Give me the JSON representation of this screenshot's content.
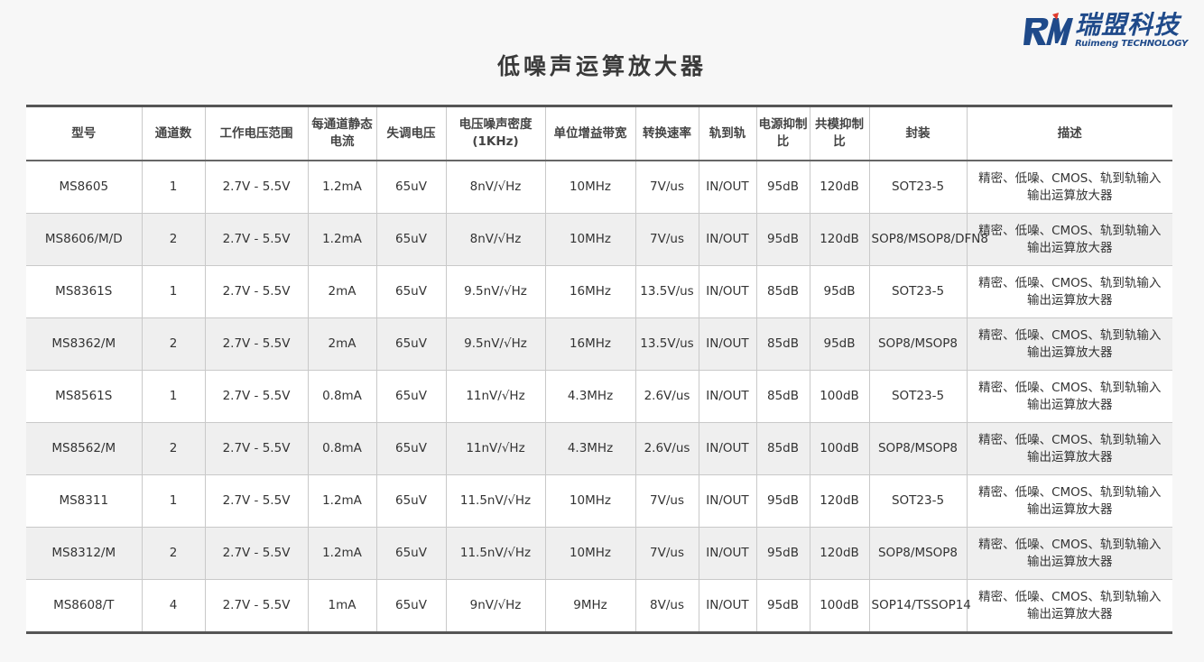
{
  "brand": {
    "name_cn": "瑞盟科技",
    "name_en": "Ruimeng TECHNOLOGY",
    "accent": "#1f4a8a",
    "logo_icon": "rm-logo-icon"
  },
  "page": {
    "title": "低噪声运算放大器"
  },
  "table": {
    "headers": [
      "型号",
      "通道数",
      "工作电压范围",
      "每通道静态电流",
      "失调电压",
      "电压噪声密度(1KHz)",
      "单位增益带宽",
      "转换速率",
      "轨到轨",
      "电源抑制比",
      "共模抑制比",
      "封装",
      "描述"
    ],
    "rows": [
      [
        "MS8605",
        "1",
        "2.7V - 5.5V",
        "1.2mA",
        "65uV",
        "8nV/√Hz",
        "10MHz",
        "7V/us",
        "IN/OUT",
        "95dB",
        "120dB",
        "SOT23-5",
        "精密、低噪、CMOS、轨到轨输入输出运算放大器"
      ],
      [
        "MS8606/M/D",
        "2",
        "2.7V - 5.5V",
        "1.2mA",
        "65uV",
        "8nV/√Hz",
        "10MHz",
        "7V/us",
        "IN/OUT",
        "95dB",
        "120dB",
        "SOP8/MSOP8/DFN8",
        "精密、低噪、CMOS、轨到轨输入输出运算放大器"
      ],
      [
        "MS8361S",
        "1",
        "2.7V - 5.5V",
        "2mA",
        "65uV",
        "9.5nV/√Hz",
        "16MHz",
        "13.5V/us",
        "IN/OUT",
        "85dB",
        "95dB",
        "SOT23-5",
        "精密、低噪、CMOS、轨到轨输入输出运算放大器"
      ],
      [
        "MS8362/M",
        "2",
        "2.7V - 5.5V",
        "2mA",
        "65uV",
        "9.5nV/√Hz",
        "16MHz",
        "13.5V/us",
        "IN/OUT",
        "85dB",
        "95dB",
        "SOP8/MSOP8",
        "精密、低噪、CMOS、轨到轨输入输出运算放大器"
      ],
      [
        "MS8561S",
        "1",
        "2.7V - 5.5V",
        "0.8mA",
        "65uV",
        "11nV/√Hz",
        "4.3MHz",
        "2.6V/us",
        "IN/OUT",
        "85dB",
        "100dB",
        "SOT23-5",
        "精密、低噪、CMOS、轨到轨输入输出运算放大器"
      ],
      [
        "MS8562/M",
        "2",
        "2.7V - 5.5V",
        "0.8mA",
        "65uV",
        "11nV/√Hz",
        "4.3MHz",
        "2.6V/us",
        "IN/OUT",
        "85dB",
        "100dB",
        "SOP8/MSOP8",
        "精密、低噪、CMOS、轨到轨输入输出运算放大器"
      ],
      [
        "MS8311",
        "1",
        "2.7V - 5.5V",
        "1.2mA",
        "65uV",
        "11.5nV/√Hz",
        "10MHz",
        "7V/us",
        "IN/OUT",
        "95dB",
        "120dB",
        "SOT23-5",
        "精密、低噪、CMOS、轨到轨输入输出运算放大器"
      ],
      [
        "MS8312/M",
        "2",
        "2.7V - 5.5V",
        "1.2mA",
        "65uV",
        "11.5nV/√Hz",
        "10MHz",
        "7V/us",
        "IN/OUT",
        "95dB",
        "120dB",
        "SOP8/MSOP8",
        "精密、低噪、CMOS、轨到轨输入输出运算放大器"
      ],
      [
        "MS8608/T",
        "4",
        "2.7V - 5.5V",
        "1mA",
        "65uV",
        "9nV/√Hz",
        "9MHz",
        "8V/us",
        "IN/OUT",
        "95dB",
        "100dB",
        "SOP14/TSSOP14",
        "精密、低噪、CMOS、轨到轨输入输出运算放大器"
      ]
    ]
  }
}
